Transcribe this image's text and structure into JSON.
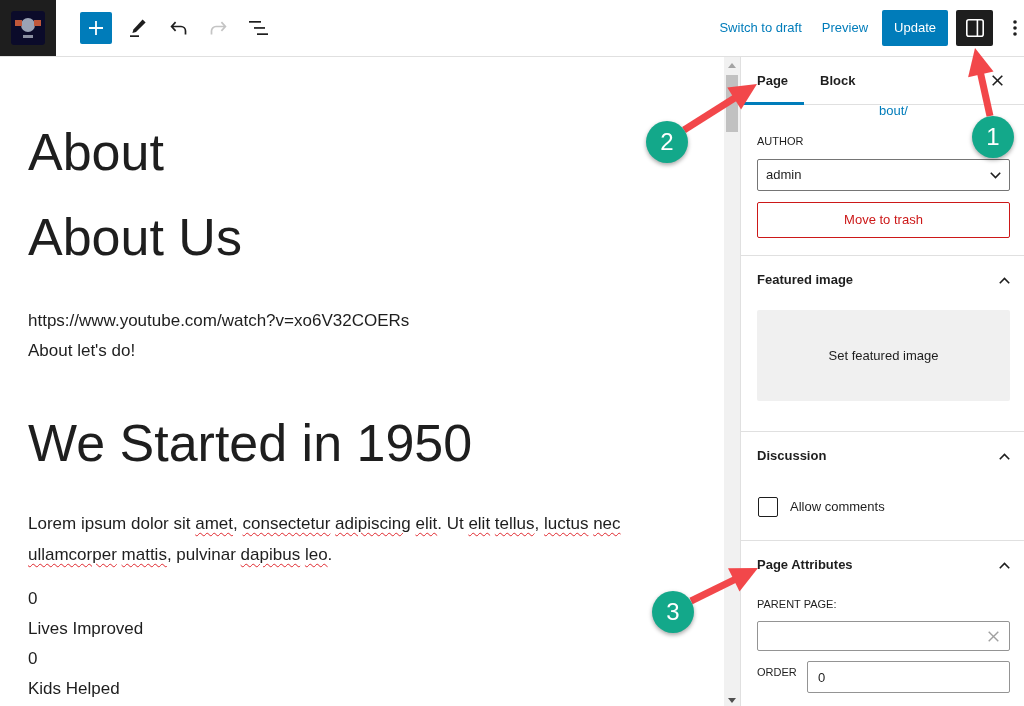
{
  "top_bar": {
    "history": [
      {
        "kind": "undo",
        "disabled": false
      },
      {
        "kind": "redo",
        "disabled": true
      }
    ],
    "switch_to_draft": "Switch to draft",
    "preview": "Preview",
    "update": "Update",
    "settings_toggle": {
      "pressed": true
    }
  },
  "editor": {
    "blocks": [
      {
        "kind": "heading",
        "text": "About"
      },
      {
        "kind": "heading",
        "text": "About Us"
      },
      {
        "kind": "lines",
        "lines": [
          "https://www.youtube.com/watch?v=xo6V32COERs",
          "About let's do!"
        ]
      },
      {
        "kind": "heading",
        "text": "We Started in 1950"
      },
      {
        "kind": "paragraph",
        "segments": [
          {
            "text": "Lorem ipsum dolor sit ",
            "misspelled": false
          },
          {
            "text": "amet, ",
            "misspelled": true
          },
          {
            "text": "consectetur ",
            "misspelled": true
          },
          {
            "text": "adipiscing ",
            "misspelled": true
          },
          {
            "text": "elit. ",
            "misspelled": true
          },
          {
            "text": "Ut ",
            "misspelled": false
          },
          {
            "text": "elit ",
            "misspelled": true
          },
          {
            "text": "tellus, ",
            "misspelled": true
          },
          {
            "text": "luctus ",
            "misspelled": true
          },
          {
            "text": "nec ",
            "misspelled": true
          },
          {
            "text": "ullamcorper ",
            "misspelled": true
          },
          {
            "text": "mattis, ",
            "misspelled": true
          },
          {
            "text": "pulvinar ",
            "misspelled": false
          },
          {
            "text": "dapibus ",
            "misspelled": true
          },
          {
            "text": "leo.",
            "misspelled": true
          }
        ]
      },
      {
        "kind": "lines",
        "lines": [
          "0",
          "Lives Improved",
          "0",
          "Kids Helped"
        ]
      }
    ]
  },
  "sidebar": {
    "tabs": [
      {
        "label": "Page",
        "selected": true
      },
      {
        "label": "Block",
        "selected": false
      }
    ],
    "permalink_fragment": "bout/",
    "author": {
      "label": "AUTHOR",
      "value": "admin"
    },
    "trash_button": "Move to trash",
    "panels": [
      {
        "kind": "featured_image",
        "title": "Featured image",
        "expanded": true,
        "button": "Set featured image"
      },
      {
        "kind": "discussion",
        "title": "Discussion",
        "expanded": true,
        "checkbox": {
          "label": "Allow comments",
          "checked": false
        }
      },
      {
        "kind": "page_attributes",
        "title": "Page Attributes",
        "expanded": true,
        "parent_label": "PARENT PAGE:",
        "order_label": "ORDER",
        "order_value": "0"
      }
    ]
  },
  "annotations": [
    {
      "number": "1"
    },
    {
      "number": "2"
    },
    {
      "number": "3"
    }
  ]
}
